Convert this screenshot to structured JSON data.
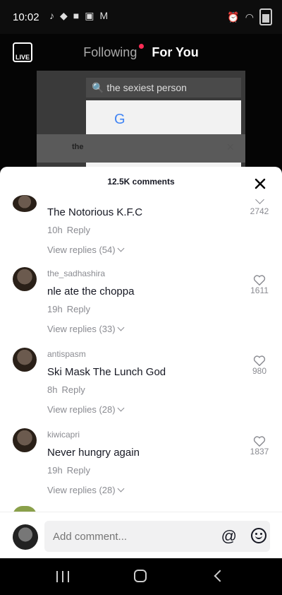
{
  "status_bar": {
    "time": "10:02"
  },
  "header": {
    "live_label": "LIVE",
    "tabs": [
      {
        "label": "Following"
      },
      {
        "label": "For You"
      }
    ]
  },
  "video": {
    "browser_search_text": "the sexiest person",
    "search_row_text": "the"
  },
  "comments": {
    "count_label": "12.5K comments",
    "items": [
      {
        "username": "",
        "text": "The Notorious K.F.C",
        "time": "10h",
        "reply_label": "Reply",
        "view_replies": "View replies (54)",
        "likes": "2742"
      },
      {
        "username": "the_sadhashira",
        "text": "nle ate the choppa",
        "time": "19h",
        "reply_label": "Reply",
        "view_replies": "View replies (33)",
        "likes": "1611"
      },
      {
        "username": "antispasm",
        "text": "Ski Mask The Lunch God",
        "time": "8h",
        "reply_label": "Reply",
        "view_replies": "View replies (28)",
        "likes": "980"
      },
      {
        "username": "kiwicapri",
        "text": "Never hungry again",
        "time": "19h",
        "reply_label": "Reply",
        "view_replies": "View replies (28)",
        "likes": "1837"
      }
    ]
  },
  "add_comment": {
    "placeholder": "Add comment...",
    "at_symbol": "@"
  }
}
